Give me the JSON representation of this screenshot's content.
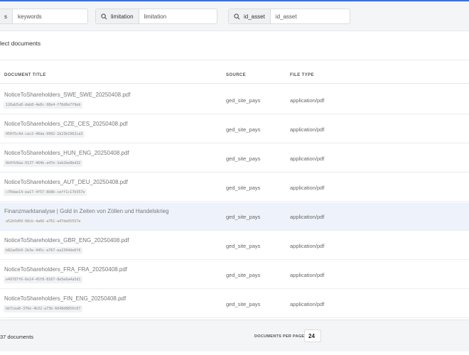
{
  "colors": {
    "accent": "#3b6fd4",
    "selected_row": "#eef3fb",
    "filter_bg": "#f4f5f7"
  },
  "filters": {
    "keywords": {
      "label": "s",
      "value": "keywords"
    },
    "limitation": {
      "label": "limitation",
      "icon": "search-icon",
      "value": "limitation"
    },
    "id_asset": {
      "label": "id_asset",
      "icon": "search-icon",
      "value": "id_asset"
    }
  },
  "section_title": "lect documents",
  "table": {
    "columns": [
      "DOCUMENT TITLE",
      "SOURCE",
      "FILE TYPE"
    ],
    "rows": [
      {
        "title": "NoticeToShareholders_SWE_SWE_20250408.pdf",
        "uuid": "126ab5a8-dab8-4e8c-98e4-f76d0e7f9eb",
        "source": "ged_site_pays",
        "file_type": "application/pdf"
      },
      {
        "title": "NoticeToShareholders_CZE_CES_20250408.pdf",
        "uuid": "450f5c4d-cac2-46da-9902-1b23b1962ca3",
        "source": "ged_site_pays",
        "file_type": "application/pdf"
      },
      {
        "title": "NoticeToShareholders_HUN_ENG_20250408.pdf",
        "uuid": "6b9fb9aa-0137-464b-a47e-1eb2be8bd32",
        "source": "ged_site_pays",
        "file_type": "application/pdf"
      },
      {
        "title": "NoticeToShareholders_AUT_DEU_20250408.pdf",
        "uuid": "c70dae14-ea17-4f57-8b8b-ceff1c17b357e",
        "source": "ged_site_pays",
        "file_type": "application/pdf"
      },
      {
        "title": "Finanzmarktanalyse | Gold in Zeiten von Zöllen und Handelskrieg",
        "uuid": "a52b5d09-68cb-4a66-a761-a47de65557e",
        "source": "ged_site_pays",
        "file_type": "application/pdf"
      },
      {
        "title": "NoticeToShareholders_GBR_ENG_20250408.pdf",
        "uuid": "b82ad5b9-2b3e-445c-a767-ea2394de6f6",
        "source": "ged_site_pays",
        "file_type": "application/pdf"
      },
      {
        "title": "NoticeToShareholders_FRA_FRA_20250408.pdf",
        "uuid": "e49787f6-6e14-45f8-8167-8e5e6a4a5d1",
        "source": "ged_site_pays",
        "file_type": "application/pdf"
      },
      {
        "title": "NoticeToShareholders_FIN_ENG_20250408.pdf",
        "uuid": "bb7cea8-376e-4b32-a73b-6648d8856c67",
        "source": "ged_site_pays",
        "file_type": "application/pdf"
      }
    ]
  },
  "footer": {
    "count": "37 documents",
    "per_page_label": "DOCUMENTS PER PAGE",
    "per_page_value": "24"
  }
}
